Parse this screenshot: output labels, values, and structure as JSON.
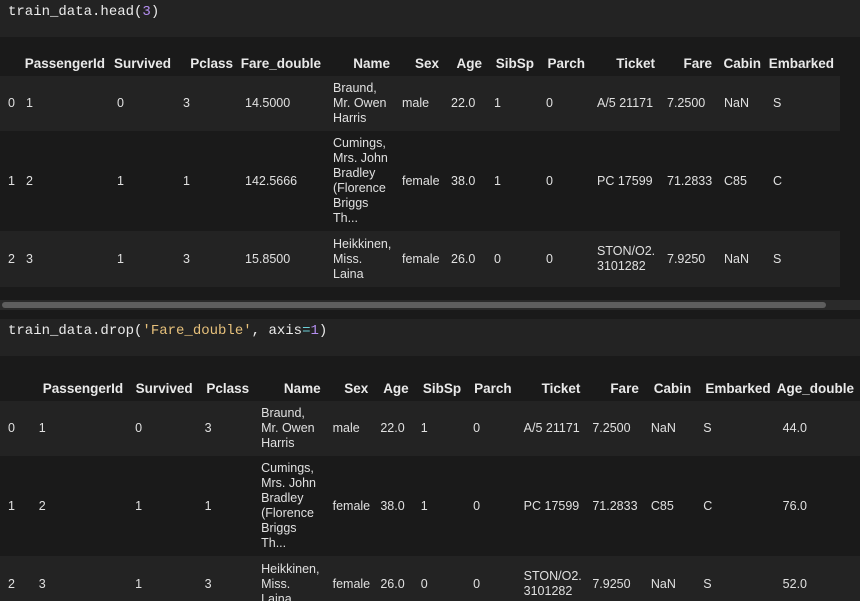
{
  "cell1": {
    "code_parts": [
      {
        "t": "train_data.head(",
        "k": "plain"
      },
      {
        "t": "3",
        "k": "num"
      },
      {
        "t": ")",
        "k": "plain"
      }
    ]
  },
  "table1": {
    "columns": [
      "",
      "PassengerId",
      "Survived",
      "Pclass",
      "Fare_double",
      "Name",
      "Sex",
      "Age",
      "SibSp",
      "Parch",
      "Ticket",
      "Fare",
      "Cabin",
      "Embarked"
    ],
    "rows": [
      [
        "0",
        "1",
        "0",
        "3",
        "14.5000",
        "Braund,\nMr. Owen\nHarris",
        "male",
        "22.0",
        "1",
        "0",
        "A/5 21171",
        "7.2500",
        "NaN",
        "S"
      ],
      [
        "1",
        "2",
        "1",
        "1",
        "142.5666",
        "Cumings,\nMrs. John\nBradley\n(Florence\nBriggs\nTh...",
        "female",
        "38.0",
        "1",
        "0",
        "PC 17599",
        "71.2833",
        "C85",
        "C"
      ],
      [
        "2",
        "3",
        "1",
        "3",
        "15.8500",
        "Heikkinen,\nMiss.\nLaina",
        "female",
        "26.0",
        "0",
        "0",
        "STON/O2.\n3101282",
        "7.9250",
        "NaN",
        "S"
      ]
    ]
  },
  "cell2": {
    "code_parts": [
      {
        "t": "train_data.drop(",
        "k": "plain"
      },
      {
        "t": "'Fare_double'",
        "k": "str"
      },
      {
        "t": ", axis",
        "k": "plain"
      },
      {
        "t": "=",
        "k": "op"
      },
      {
        "t": "1",
        "k": "num"
      },
      {
        "t": ")",
        "k": "plain"
      }
    ]
  },
  "table2": {
    "columns": [
      "",
      "PassengerId",
      "Survived",
      "Pclass",
      "Name",
      "Sex",
      "Age",
      "SibSp",
      "Parch",
      "Ticket",
      "Fare",
      "Cabin",
      "Embarked",
      "Age_double"
    ],
    "rows": [
      [
        "0",
        "1",
        "0",
        "3",
        "Braund,\nMr. Owen\nHarris",
        "male",
        "22.0",
        "1",
        "0",
        "A/5 21171",
        "7.2500",
        "NaN",
        "S",
        "44.0"
      ],
      [
        "1",
        "2",
        "1",
        "1",
        "Cumings,\nMrs. John\nBradley\n(Florence\nBriggs\nTh...",
        "female",
        "38.0",
        "1",
        "0",
        "PC 17599",
        "71.2833",
        "C85",
        "C",
        "76.0"
      ],
      [
        "2",
        "3",
        "1",
        "3",
        "Heikkinen,\nMiss.\nLaina",
        "female",
        "26.0",
        "0",
        "0",
        "STON/O2.\n3101282",
        "7.9250",
        "NaN",
        "S",
        "52.0"
      ]
    ]
  },
  "colors": {
    "background": "#1a1a1a",
    "stripe": "#232323",
    "number": "#b48ef0",
    "string": "#e6c07b",
    "operator": "#6ccfd7"
  }
}
